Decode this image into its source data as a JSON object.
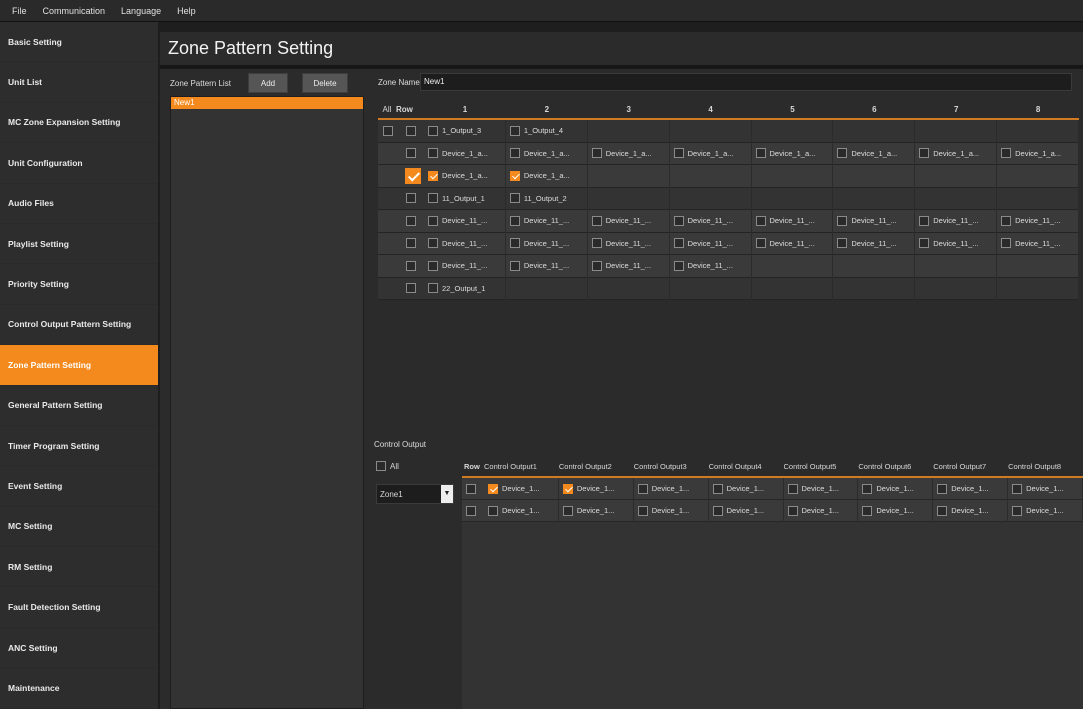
{
  "menu": [
    "File",
    "Communication",
    "Language",
    "Help"
  ],
  "sidebar": [
    "Basic Setting",
    "Unit List",
    "MC Zone Expansion Setting",
    "Unit Configuration",
    "Audio Files",
    "Playlist Setting",
    "Priority Setting",
    "Control Output Pattern Setting",
    "Zone Pattern Setting",
    "General Pattern Setting",
    "Timer Program Setting",
    "Event Setting",
    "MC Setting",
    "RM Setting",
    "Fault Detection Setting",
    "ANC Setting",
    "Maintenance"
  ],
  "sidebar_active": "Zone Pattern Setting",
  "page_title": "Zone Pattern Setting",
  "zone_pattern_list": {
    "label": "Zone Pattern List",
    "add_label": "Add",
    "delete_label": "Delete",
    "items": [
      "New1"
    ]
  },
  "zone_name": {
    "label": "Zone Name",
    "value": "New1"
  },
  "grid": {
    "all_label": "All",
    "row_label": "Row",
    "columns": [
      "1",
      "2",
      "3",
      "4",
      "5",
      "6",
      "7",
      "8"
    ],
    "rows": [
      {
        "row_checked": false,
        "cells": [
          {
            "t": "1_Output_3",
            "c": false
          },
          {
            "t": "1_Output_4",
            "c": false
          }
        ]
      },
      {
        "row_checked": false,
        "cells": [
          {
            "t": "Device_1_a...",
            "c": false
          },
          {
            "t": "Device_1_a...",
            "c": false
          },
          {
            "t": "Device_1_a...",
            "c": false
          },
          {
            "t": "Device_1_a...",
            "c": false
          },
          {
            "t": "Device_1_a...",
            "c": false
          },
          {
            "t": "Device_1_a...",
            "c": false
          },
          {
            "t": "Device_1_a...",
            "c": false
          },
          {
            "t": "Device_1_a...",
            "c": false
          }
        ]
      },
      {
        "row_checked": true,
        "cells": [
          {
            "t": "Device_1_a...",
            "c": true
          },
          {
            "t": "Device_1_a...",
            "c": true
          }
        ]
      },
      {
        "row_checked": false,
        "cells": [
          {
            "t": "11_Output_1",
            "c": false
          },
          {
            "t": "11_Output_2",
            "c": false
          }
        ]
      },
      {
        "row_checked": false,
        "cells": [
          {
            "t": "Device_11_...",
            "c": false
          },
          {
            "t": "Device_11_...",
            "c": false
          },
          {
            "t": "Device_11_...",
            "c": false
          },
          {
            "t": "Device_11_...",
            "c": false
          },
          {
            "t": "Device_11_...",
            "c": false
          },
          {
            "t": "Device_11_...",
            "c": false
          },
          {
            "t": "Device_11_...",
            "c": false
          },
          {
            "t": "Device_11_...",
            "c": false
          }
        ]
      },
      {
        "row_checked": false,
        "cells": [
          {
            "t": "Device_11_...",
            "c": false
          },
          {
            "t": "Device_11_...",
            "c": false
          },
          {
            "t": "Device_11_...",
            "c": false
          },
          {
            "t": "Device_11_...",
            "c": false
          },
          {
            "t": "Device_11_...",
            "c": false
          },
          {
            "t": "Device_11_...",
            "c": false
          },
          {
            "t": "Device_11_...",
            "c": false
          },
          {
            "t": "Device_11_...",
            "c": false
          }
        ]
      },
      {
        "row_checked": false,
        "cells": [
          {
            "t": "Device_11_...",
            "c": false
          },
          {
            "t": "Device_11_...",
            "c": false
          },
          {
            "t": "Device_11_...",
            "c": false
          },
          {
            "t": "Device_11_...",
            "c": false
          }
        ]
      },
      {
        "row_checked": false,
        "cells": [
          {
            "t": "22_Output_1",
            "c": false
          }
        ]
      }
    ]
  },
  "control_output": {
    "label": "Control Output",
    "all_label": "All",
    "select_value": "Zone1",
    "row_label": "Row",
    "columns": [
      "Control Output1",
      "Control Output2",
      "Control Output3",
      "Control Output4",
      "Control Output5",
      "Control Output6",
      "Control Output7",
      "Control Output8"
    ],
    "rows": [
      {
        "cells": [
          {
            "t": "Device_1...",
            "c": true
          },
          {
            "t": "Device_1...",
            "c": true
          },
          {
            "t": "Device_1...",
            "c": false
          },
          {
            "t": "Device_1...",
            "c": false
          },
          {
            "t": "Device_1...",
            "c": false
          },
          {
            "t": "Device_1...",
            "c": false
          },
          {
            "t": "Device_1...",
            "c": false
          },
          {
            "t": "Device_1...",
            "c": false
          }
        ]
      },
      {
        "cells": [
          {
            "t": "Device_1...",
            "c": false
          },
          {
            "t": "Device_1...",
            "c": false
          },
          {
            "t": "Device_1...",
            "c": false
          },
          {
            "t": "Device_1...",
            "c": false
          },
          {
            "t": "Device_1...",
            "c": false
          },
          {
            "t": "Device_1...",
            "c": false
          },
          {
            "t": "Device_1...",
            "c": false
          },
          {
            "t": "Device_1...",
            "c": false
          }
        ]
      }
    ]
  },
  "colors": {
    "accent": "#f48a1d",
    "background": "#2b2b2b",
    "sidebar": "#2d2d2d"
  }
}
